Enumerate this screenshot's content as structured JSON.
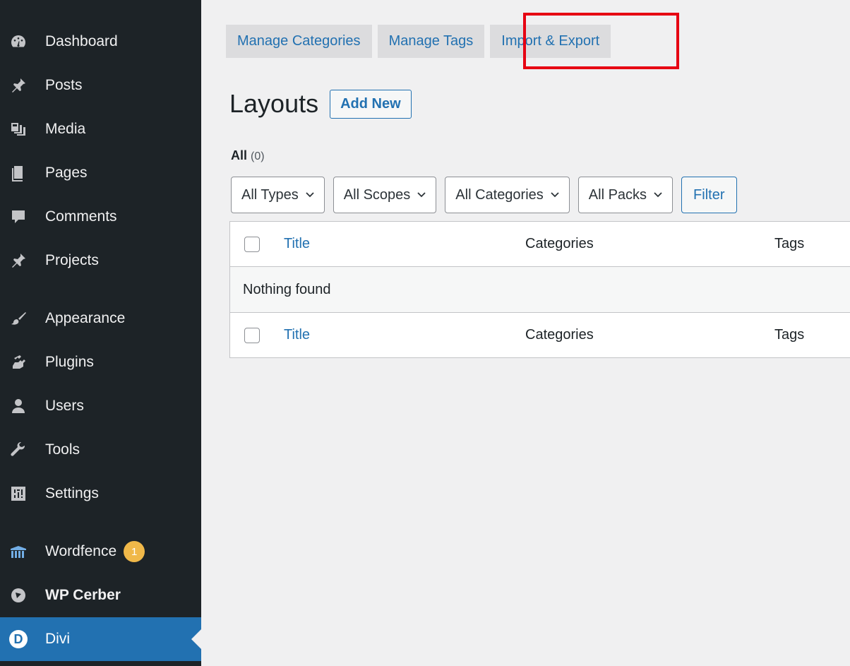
{
  "sidebar": {
    "items": [
      {
        "label": "Dashboard",
        "icon": "dashboard-icon"
      },
      {
        "label": "Posts",
        "icon": "pin-icon"
      },
      {
        "label": "Media",
        "icon": "media-icon"
      },
      {
        "label": "Pages",
        "icon": "pages-icon"
      },
      {
        "label": "Comments",
        "icon": "comment-icon"
      },
      {
        "label": "Projects",
        "icon": "pin-icon"
      },
      {
        "label": "Appearance",
        "icon": "brush-icon"
      },
      {
        "label": "Plugins",
        "icon": "plugin-icon"
      },
      {
        "label": "Users",
        "icon": "users-icon"
      },
      {
        "label": "Tools",
        "icon": "wrench-icon"
      },
      {
        "label": "Settings",
        "icon": "settings-icon"
      },
      {
        "label": "Wordfence",
        "icon": "wordfence-icon",
        "badge": "1"
      },
      {
        "label": "WP Cerber",
        "icon": "cerber-icon"
      },
      {
        "label": "Divi",
        "icon": "divi-icon",
        "active": true,
        "icon_letter": "D"
      }
    ]
  },
  "tabs": [
    {
      "label": "Manage Categories"
    },
    {
      "label": "Manage Tags"
    },
    {
      "label": "Import & Export",
      "highlighted": true
    }
  ],
  "page": {
    "title": "Layouts",
    "add_new_label": "Add New"
  },
  "views": {
    "all_label": "All",
    "all_count": "(0)"
  },
  "filters": {
    "types": "All Types",
    "scopes": "All Scopes",
    "categories": "All Categories",
    "packs": "All Packs",
    "filter_button": "Filter"
  },
  "table": {
    "columns": [
      "Title",
      "Categories",
      "Tags"
    ],
    "empty_message": "Nothing found"
  },
  "colors": {
    "sidebar_bg": "#1d2327",
    "accent": "#2271b1",
    "highlight": "#e60012",
    "badge": "#f0b849"
  }
}
